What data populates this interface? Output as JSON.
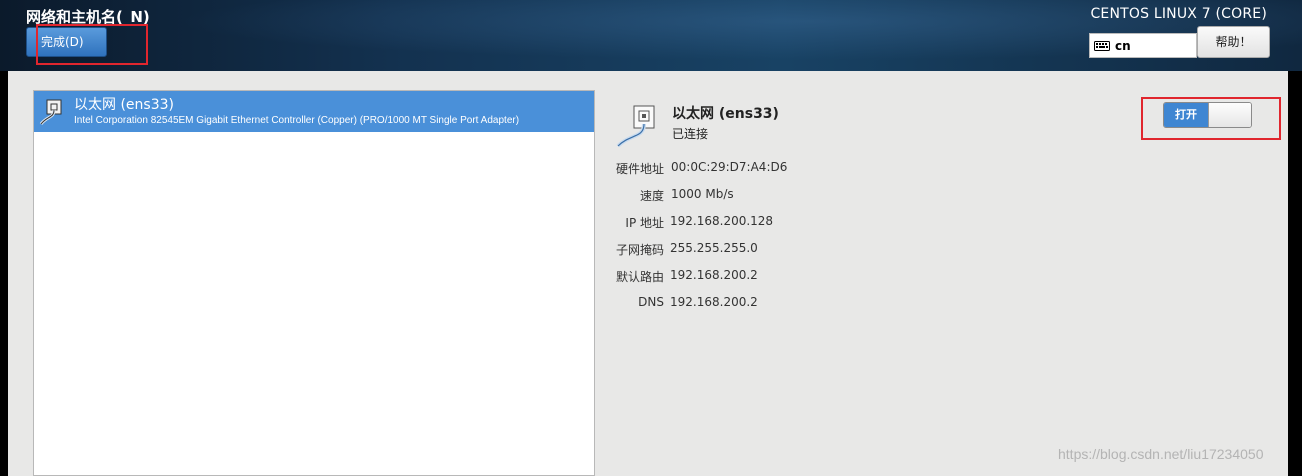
{
  "header": {
    "title": "网络和主机名(_N)",
    "done_label": "完成(D)",
    "product": "CENTOS LINUX 7 (CORE)",
    "keyboard_layout": "cn",
    "help_label": "帮助！"
  },
  "device_list": {
    "items": [
      {
        "name": "以太网 (ens33)",
        "description": "Intel Corporation 82545EM Gigabit Ethernet Controller (Copper) (PRO/1000 MT Single Port Adapter)"
      }
    ]
  },
  "detail": {
    "name": "以太网 (ens33)",
    "status": "已连接",
    "toggle_label": "打开",
    "toggle_on": true,
    "rows": [
      {
        "label": "硬件地址",
        "value": "00:0C:29:D7:A4:D6"
      },
      {
        "label": "速度",
        "value": "1000 Mb/s"
      },
      {
        "label": "IP 地址",
        "value": "192.168.200.128"
      },
      {
        "label": "子网掩码",
        "value": "255.255.255.0"
      },
      {
        "label": "默认路由",
        "value": "192.168.200.2"
      },
      {
        "label": "DNS",
        "value": "192.168.200.2"
      }
    ]
  },
  "watermark": "https://blog.csdn.net/liu17234050",
  "colors": {
    "accent": "#4a90d9",
    "highlight": "#e0262e"
  }
}
